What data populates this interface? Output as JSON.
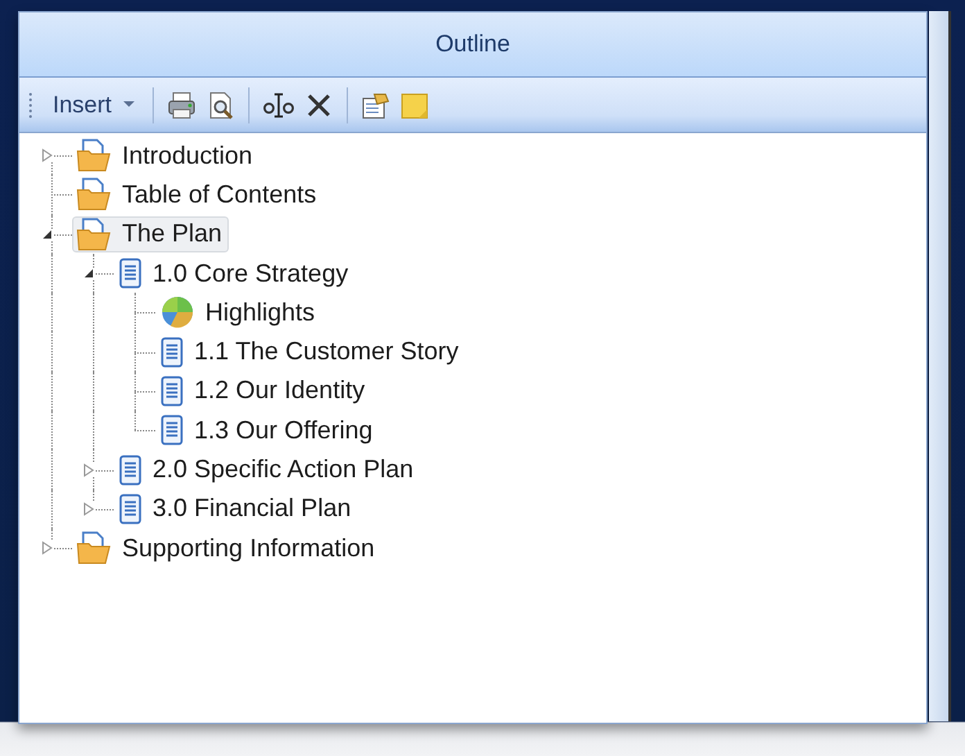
{
  "panel": {
    "title": "Outline"
  },
  "toolbar": {
    "insert_label": "Insert",
    "tools": [
      {
        "kind": "print"
      },
      {
        "kind": "preview"
      },
      {
        "kind": "separator"
      },
      {
        "kind": "rename"
      },
      {
        "kind": "delete"
      },
      {
        "kind": "separator"
      },
      {
        "kind": "properties"
      },
      {
        "kind": "note"
      }
    ]
  },
  "tree": [
    {
      "label": "Introduction",
      "kind": "folder",
      "expanded": false,
      "selected": false
    },
    {
      "label": "Table of Contents",
      "kind": "folder",
      "selected": false
    },
    {
      "label": "The Plan",
      "kind": "folder",
      "expanded": true,
      "selected": true,
      "children": [
        {
          "label": "1.0 Core Strategy",
          "kind": "doc",
          "expanded": true,
          "selected": false,
          "children": [
            {
              "label": "Highlights",
              "kind": "chart",
              "selected": false
            },
            {
              "label": "1.1 The Customer Story",
              "kind": "doc",
              "selected": false
            },
            {
              "label": "1.2 Our Identity",
              "kind": "doc",
              "selected": false
            },
            {
              "label": "1.3 Our Offering",
              "kind": "doc",
              "selected": false
            }
          ]
        },
        {
          "label": "2.0 Specific Action Plan",
          "kind": "doc",
          "expanded": false,
          "selected": false
        },
        {
          "label": "3.0 Financial Plan",
          "kind": "doc",
          "expanded": false,
          "selected": false
        }
      ]
    },
    {
      "label": "Supporting Information",
      "kind": "folder",
      "expanded": false,
      "selected": false
    }
  ]
}
